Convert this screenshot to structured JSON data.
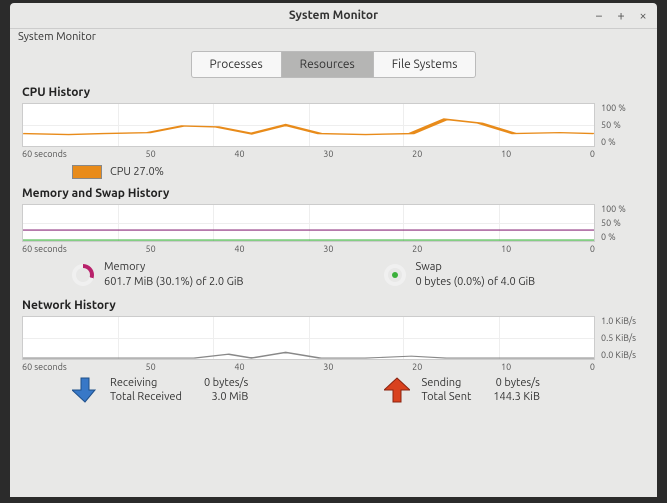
{
  "window": {
    "title": "System Monitor",
    "menu": "System Monitor"
  },
  "tabs": {
    "processes": "Processes",
    "resources": "Resources",
    "filesystems": "File Systems",
    "active": "resources"
  },
  "cpu": {
    "title": "CPU History",
    "y": [
      "100 %",
      "50 %",
      "0 %"
    ],
    "legend": "CPU  27.0%"
  },
  "mem": {
    "title": "Memory and Swap History",
    "y": [
      "100 %",
      "50 %",
      "0 %"
    ],
    "memory": {
      "label": "Memory",
      "value": "601.7 MiB (30.1%) of 2.0 GiB"
    },
    "swap": {
      "label": "Swap",
      "value": "0 bytes (0.0%) of 4.0 GiB"
    }
  },
  "net": {
    "title": "Network History",
    "y": [
      "1.0 KiB/s",
      "0.5 KiB/s",
      "0.0 KiB/s"
    ],
    "recv": {
      "label": "Receiving",
      "rate": "0 bytes/s",
      "total_label": "Total Received",
      "total": "3.0 MiB"
    },
    "send": {
      "label": "Sending",
      "rate": "0 bytes/s",
      "total_label": "Total Sent",
      "total": "144.3 KiB"
    }
  },
  "x_labels": [
    "60 seconds",
    "50",
    "40",
    "30",
    "20",
    "10",
    "0"
  ],
  "chart_data": [
    {
      "type": "line",
      "title": "CPU History",
      "ylabel": "%",
      "ylim": [
        0,
        100
      ],
      "x": [
        60,
        55,
        50,
        45,
        40,
        35,
        30,
        25,
        20,
        15,
        10,
        5,
        0
      ],
      "series": [
        {
          "name": "CPU",
          "color": "#e88b1a",
          "values": [
            30,
            28,
            29,
            30,
            48,
            45,
            30,
            50,
            30,
            28,
            65,
            52,
            30
          ]
        }
      ]
    },
    {
      "type": "line",
      "title": "Memory and Swap History",
      "ylabel": "%",
      "ylim": [
        0,
        100
      ],
      "x": [
        60,
        0
      ],
      "series": [
        {
          "name": "Memory",
          "color": "#b8216b",
          "values": [
            30.1,
            30.1
          ]
        },
        {
          "name": "Swap",
          "color": "#3bb03b",
          "values": [
            0,
            0
          ]
        }
      ]
    },
    {
      "type": "line",
      "title": "Network History",
      "ylabel": "KiB/s",
      "ylim": [
        0,
        1.0
      ],
      "x": [
        60,
        55,
        50,
        45,
        40,
        35,
        30,
        25,
        20,
        15,
        10,
        5,
        0
      ],
      "series": [
        {
          "name": "Receiving",
          "color": "#3878c7",
          "values": [
            0,
            0,
            0,
            0,
            0,
            0.1,
            0,
            0.15,
            0,
            0,
            0.05,
            0,
            0
          ]
        },
        {
          "name": "Sending",
          "color": "#d9411e",
          "values": [
            0,
            0,
            0,
            0,
            0,
            0.08,
            0,
            0.1,
            0,
            0,
            0.04,
            0,
            0
          ]
        }
      ]
    }
  ]
}
